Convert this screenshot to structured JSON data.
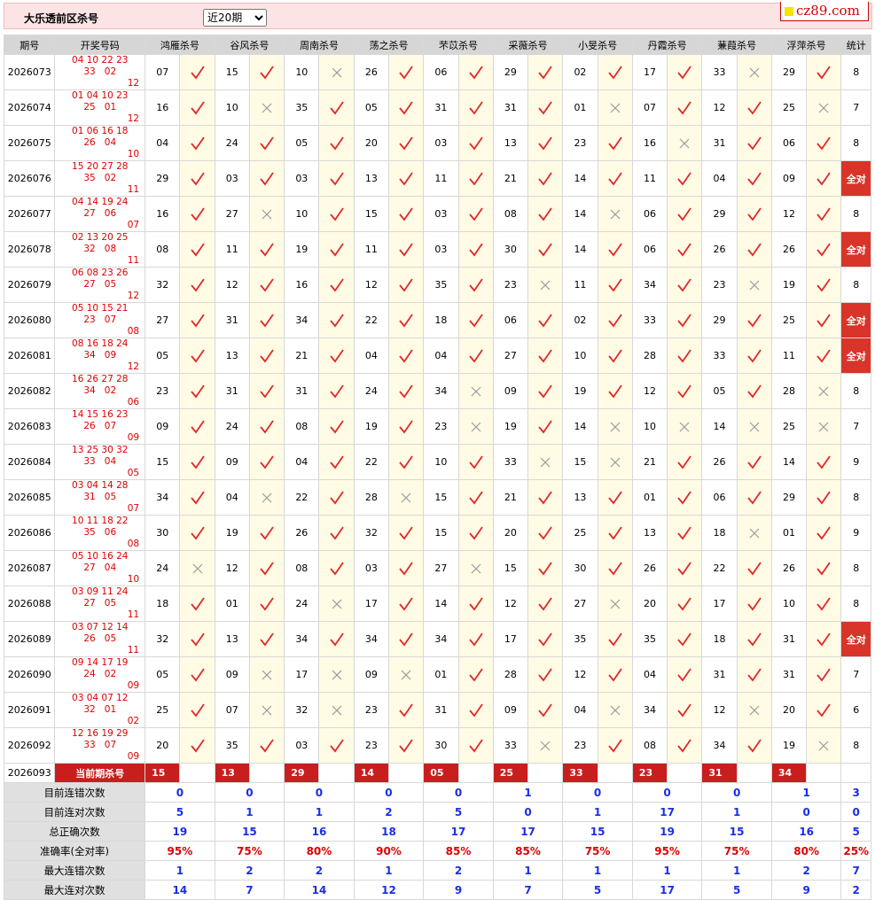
{
  "header": {
    "title": "大乐透前区杀号",
    "period_selected": "近20期",
    "period_options": [
      "近20期"
    ],
    "logo": "cz89.com"
  },
  "columns": [
    "期号",
    "开奖号码",
    "鸿雁杀号",
    "谷风杀号",
    "周南杀号",
    "荡之杀号",
    "芣苡杀号",
    "采薇杀号",
    "小旻杀号",
    "丹霞杀号",
    "蒹葭杀号",
    "浮萍杀号",
    "统计"
  ],
  "rows": [
    {
      "issue": "2026073",
      "draw_line1": "04 10 22 23 33",
      "draw_back1": "02",
      "draw_back2": "12",
      "picks": [
        [
          "07",
          "r"
        ],
        [
          "15",
          "r"
        ],
        [
          "10",
          "x"
        ],
        [
          "26",
          "r"
        ],
        [
          "06",
          "r"
        ],
        [
          "29",
          "r"
        ],
        [
          "02",
          "r"
        ],
        [
          "17",
          "r"
        ],
        [
          "33",
          "x"
        ],
        [
          "29",
          "r"
        ]
      ],
      "stat": "8"
    },
    {
      "issue": "2026074",
      "draw_line1": "01 04 10 23 25",
      "draw_back1": "01",
      "draw_back2": "12",
      "picks": [
        [
          "16",
          "r"
        ],
        [
          "10",
          "x"
        ],
        [
          "35",
          "r"
        ],
        [
          "05",
          "r"
        ],
        [
          "31",
          "r"
        ],
        [
          "31",
          "r"
        ],
        [
          "01",
          "x"
        ],
        [
          "07",
          "r"
        ],
        [
          "12",
          "r"
        ],
        [
          "25",
          "x"
        ]
      ],
      "stat": "7"
    },
    {
      "issue": "2026075",
      "draw_line1": "01 06 16 18 26",
      "draw_back1": "04",
      "draw_back2": "10",
      "picks": [
        [
          "04",
          "r"
        ],
        [
          "24",
          "r"
        ],
        [
          "05",
          "r"
        ],
        [
          "20",
          "r"
        ],
        [
          "03",
          "r"
        ],
        [
          "13",
          "r"
        ],
        [
          "23",
          "r"
        ],
        [
          "16",
          "x"
        ],
        [
          "31",
          "r"
        ],
        [
          "06",
          "r"
        ]
      ],
      "stat": "8"
    },
    {
      "issue": "2026076",
      "draw_line1": "15 20 27 28 35",
      "draw_back1": "02",
      "draw_back2": "11",
      "picks": [
        [
          "29",
          "r"
        ],
        [
          "03",
          "r"
        ],
        [
          "03",
          "r"
        ],
        [
          "13",
          "r"
        ],
        [
          "11",
          "r"
        ],
        [
          "21",
          "r"
        ],
        [
          "14",
          "r"
        ],
        [
          "11",
          "r"
        ],
        [
          "04",
          "r"
        ],
        [
          "09",
          "r"
        ]
      ],
      "stat": "全对"
    },
    {
      "issue": "2026077",
      "draw_line1": "04 14 19 24 27",
      "draw_back1": "06",
      "draw_back2": "07",
      "picks": [
        [
          "16",
          "r"
        ],
        [
          "27",
          "x"
        ],
        [
          "10",
          "r"
        ],
        [
          "15",
          "r"
        ],
        [
          "03",
          "r"
        ],
        [
          "08",
          "r"
        ],
        [
          "14",
          "x"
        ],
        [
          "06",
          "r"
        ],
        [
          "29",
          "r"
        ],
        [
          "12",
          "r"
        ]
      ],
      "stat": "8"
    },
    {
      "issue": "2026078",
      "draw_line1": "02 13 20 25 32",
      "draw_back1": "08",
      "draw_back2": "11",
      "picks": [
        [
          "08",
          "r"
        ],
        [
          "11",
          "r"
        ],
        [
          "19",
          "r"
        ],
        [
          "11",
          "r"
        ],
        [
          "03",
          "r"
        ],
        [
          "30",
          "r"
        ],
        [
          "14",
          "r"
        ],
        [
          "06",
          "r"
        ],
        [
          "26",
          "r"
        ],
        [
          "26",
          "r"
        ]
      ],
      "stat": "全对"
    },
    {
      "issue": "2026079",
      "draw_line1": "06 08 23 26 27",
      "draw_back1": "05",
      "draw_back2": "12",
      "picks": [
        [
          "32",
          "r"
        ],
        [
          "12",
          "r"
        ],
        [
          "16",
          "r"
        ],
        [
          "12",
          "r"
        ],
        [
          "35",
          "r"
        ],
        [
          "23",
          "x"
        ],
        [
          "11",
          "r"
        ],
        [
          "34",
          "r"
        ],
        [
          "23",
          "x"
        ],
        [
          "19",
          "r"
        ]
      ],
      "stat": "8"
    },
    {
      "issue": "2026080",
      "draw_line1": "05 10 15 21 23",
      "draw_back1": "07",
      "draw_back2": "08",
      "picks": [
        [
          "27",
          "r"
        ],
        [
          "31",
          "r"
        ],
        [
          "34",
          "r"
        ],
        [
          "22",
          "r"
        ],
        [
          "18",
          "r"
        ],
        [
          "06",
          "r"
        ],
        [
          "02",
          "r"
        ],
        [
          "33",
          "r"
        ],
        [
          "29",
          "r"
        ],
        [
          "25",
          "r"
        ]
      ],
      "stat": "全对"
    },
    {
      "issue": "2026081",
      "draw_line1": "08 16 18 24 34",
      "draw_back1": "09",
      "draw_back2": "12",
      "picks": [
        [
          "05",
          "r"
        ],
        [
          "13",
          "r"
        ],
        [
          "21",
          "r"
        ],
        [
          "04",
          "r"
        ],
        [
          "04",
          "r"
        ],
        [
          "27",
          "r"
        ],
        [
          "10",
          "r"
        ],
        [
          "28",
          "r"
        ],
        [
          "33",
          "r"
        ],
        [
          "11",
          "r"
        ]
      ],
      "stat": "全对"
    },
    {
      "issue": "2026082",
      "draw_line1": "16 26 27 28 34",
      "draw_back1": "02",
      "draw_back2": "06",
      "picks": [
        [
          "23",
          "r"
        ],
        [
          "31",
          "r"
        ],
        [
          "31",
          "r"
        ],
        [
          "24",
          "r"
        ],
        [
          "34",
          "x"
        ],
        [
          "09",
          "r"
        ],
        [
          "19",
          "r"
        ],
        [
          "12",
          "r"
        ],
        [
          "05",
          "r"
        ],
        [
          "28",
          "x"
        ]
      ],
      "stat": "8"
    },
    {
      "issue": "2026083",
      "draw_line1": "14 15 16 23 26",
      "draw_back1": "07",
      "draw_back2": "09",
      "picks": [
        [
          "09",
          "r"
        ],
        [
          "24",
          "r"
        ],
        [
          "08",
          "r"
        ],
        [
          "19",
          "r"
        ],
        [
          "23",
          "x"
        ],
        [
          "19",
          "r"
        ],
        [
          "14",
          "x"
        ],
        [
          "10",
          "x"
        ],
        [
          "14",
          "x"
        ],
        [
          "25",
          "x"
        ]
      ],
      "stat": "7"
    },
    {
      "issue": "2026084",
      "draw_line1": "13 25 30 32 33",
      "draw_back1": "04",
      "draw_back2": "05",
      "picks": [
        [
          "15",
          "r"
        ],
        [
          "09",
          "r"
        ],
        [
          "04",
          "r"
        ],
        [
          "22",
          "r"
        ],
        [
          "10",
          "r"
        ],
        [
          "33",
          "x"
        ],
        [
          "15",
          "x"
        ],
        [
          "21",
          "r"
        ],
        [
          "26",
          "r"
        ],
        [
          "14",
          "r"
        ]
      ],
      "stat": "9"
    },
    {
      "issue": "2026085",
      "draw_line1": "03 04 14 28 31",
      "draw_back1": "05",
      "draw_back2": "07",
      "picks": [
        [
          "34",
          "r"
        ],
        [
          "04",
          "x"
        ],
        [
          "22",
          "r"
        ],
        [
          "28",
          "x"
        ],
        [
          "15",
          "r"
        ],
        [
          "21",
          "r"
        ],
        [
          "13",
          "r"
        ],
        [
          "01",
          "r"
        ],
        [
          "06",
          "r"
        ],
        [
          "29",
          "r"
        ]
      ],
      "stat": "8"
    },
    {
      "issue": "2026086",
      "draw_line1": "10 11 18 22 35",
      "draw_back1": "06",
      "draw_back2": "08",
      "picks": [
        [
          "30",
          "r"
        ],
        [
          "19",
          "r"
        ],
        [
          "26",
          "r"
        ],
        [
          "32",
          "r"
        ],
        [
          "15",
          "r"
        ],
        [
          "20",
          "r"
        ],
        [
          "25",
          "r"
        ],
        [
          "13",
          "r"
        ],
        [
          "18",
          "x"
        ],
        [
          "01",
          "r"
        ]
      ],
      "stat": "9"
    },
    {
      "issue": "2026087",
      "draw_line1": "05 10 16 24 27",
      "draw_back1": "04",
      "draw_back2": "10",
      "picks": [
        [
          "24",
          "x"
        ],
        [
          "12",
          "r"
        ],
        [
          "08",
          "r"
        ],
        [
          "03",
          "r"
        ],
        [
          "27",
          "x"
        ],
        [
          "15",
          "r"
        ],
        [
          "30",
          "r"
        ],
        [
          "26",
          "r"
        ],
        [
          "22",
          "r"
        ],
        [
          "26",
          "r"
        ]
      ],
      "stat": "8"
    },
    {
      "issue": "2026088",
      "draw_line1": "03 09 11 24 27",
      "draw_back1": "05",
      "draw_back2": "11",
      "picks": [
        [
          "18",
          "r"
        ],
        [
          "01",
          "r"
        ],
        [
          "24",
          "x"
        ],
        [
          "17",
          "r"
        ],
        [
          "14",
          "r"
        ],
        [
          "12",
          "r"
        ],
        [
          "27",
          "x"
        ],
        [
          "20",
          "r"
        ],
        [
          "17",
          "r"
        ],
        [
          "10",
          "r"
        ]
      ],
      "stat": "8"
    },
    {
      "issue": "2026089",
      "draw_line1": "03 07 12 14 26",
      "draw_back1": "05",
      "draw_back2": "11",
      "picks": [
        [
          "32",
          "r"
        ],
        [
          "13",
          "r"
        ],
        [
          "34",
          "r"
        ],
        [
          "34",
          "r"
        ],
        [
          "34",
          "r"
        ],
        [
          "17",
          "r"
        ],
        [
          "35",
          "r"
        ],
        [
          "35",
          "r"
        ],
        [
          "18",
          "r"
        ],
        [
          "31",
          "r"
        ]
      ],
      "stat": "全对"
    },
    {
      "issue": "2026090",
      "draw_line1": "09 14 17 19 24",
      "draw_back1": "02",
      "draw_back2": "09",
      "picks": [
        [
          "05",
          "r"
        ],
        [
          "09",
          "x"
        ],
        [
          "17",
          "x"
        ],
        [
          "09",
          "x"
        ],
        [
          "01",
          "r"
        ],
        [
          "28",
          "r"
        ],
        [
          "12",
          "r"
        ],
        [
          "04",
          "r"
        ],
        [
          "31",
          "r"
        ],
        [
          "31",
          "r"
        ]
      ],
      "stat": "7"
    },
    {
      "issue": "2026091",
      "draw_line1": "03 04 07 12 32",
      "draw_back1": "01",
      "draw_back2": "02",
      "picks": [
        [
          "25",
          "r"
        ],
        [
          "07",
          "x"
        ],
        [
          "32",
          "x"
        ],
        [
          "23",
          "r"
        ],
        [
          "31",
          "r"
        ],
        [
          "09",
          "r"
        ],
        [
          "04",
          "x"
        ],
        [
          "34",
          "r"
        ],
        [
          "12",
          "x"
        ],
        [
          "20",
          "r"
        ]
      ],
      "stat": "6"
    },
    {
      "issue": "2026092",
      "draw_line1": "12 16 19 29 33",
      "draw_back1": "07",
      "draw_back2": "09",
      "picks": [
        [
          "20",
          "r"
        ],
        [
          "35",
          "r"
        ],
        [
          "03",
          "r"
        ],
        [
          "23",
          "r"
        ],
        [
          "30",
          "r"
        ],
        [
          "33",
          "x"
        ],
        [
          "23",
          "r"
        ],
        [
          "08",
          "r"
        ],
        [
          "34",
          "r"
        ],
        [
          "19",
          "x"
        ]
      ],
      "stat": "8"
    }
  ],
  "current": {
    "issue": "2026093",
    "label": "当前期杀号",
    "picks": [
      "15",
      "13",
      "29",
      "14",
      "05",
      "25",
      "33",
      "23",
      "31",
      "34"
    ]
  },
  "summary": [
    {
      "label": "目前连错次数",
      "values": [
        "0",
        "0",
        "0",
        "0",
        "0",
        "1",
        "0",
        "0",
        "0",
        "1",
        "3"
      ],
      "color": "blue"
    },
    {
      "label": "目前连对次数",
      "values": [
        "5",
        "1",
        "1",
        "2",
        "5",
        "0",
        "1",
        "17",
        "1",
        "0",
        "0"
      ],
      "color": "blue"
    },
    {
      "label": "总正确次数",
      "values": [
        "19",
        "15",
        "16",
        "18",
        "17",
        "17",
        "15",
        "19",
        "15",
        "16",
        "5"
      ],
      "color": "blue"
    },
    {
      "label": "准确率(全对率)",
      "values": [
        "95%",
        "75%",
        "80%",
        "90%",
        "85%",
        "85%",
        "75%",
        "95%",
        "75%",
        "80%",
        "25%"
      ],
      "color": "red"
    },
    {
      "label": "最大连错次数",
      "values": [
        "1",
        "2",
        "2",
        "1",
        "2",
        "1",
        "1",
        "1",
        "1",
        "2",
        "7"
      ],
      "color": "blue"
    },
    {
      "label": "最大连对次数",
      "values": [
        "14",
        "7",
        "14",
        "12",
        "9",
        "7",
        "5",
        "17",
        "5",
        "9",
        "2"
      ],
      "color": "blue"
    }
  ]
}
